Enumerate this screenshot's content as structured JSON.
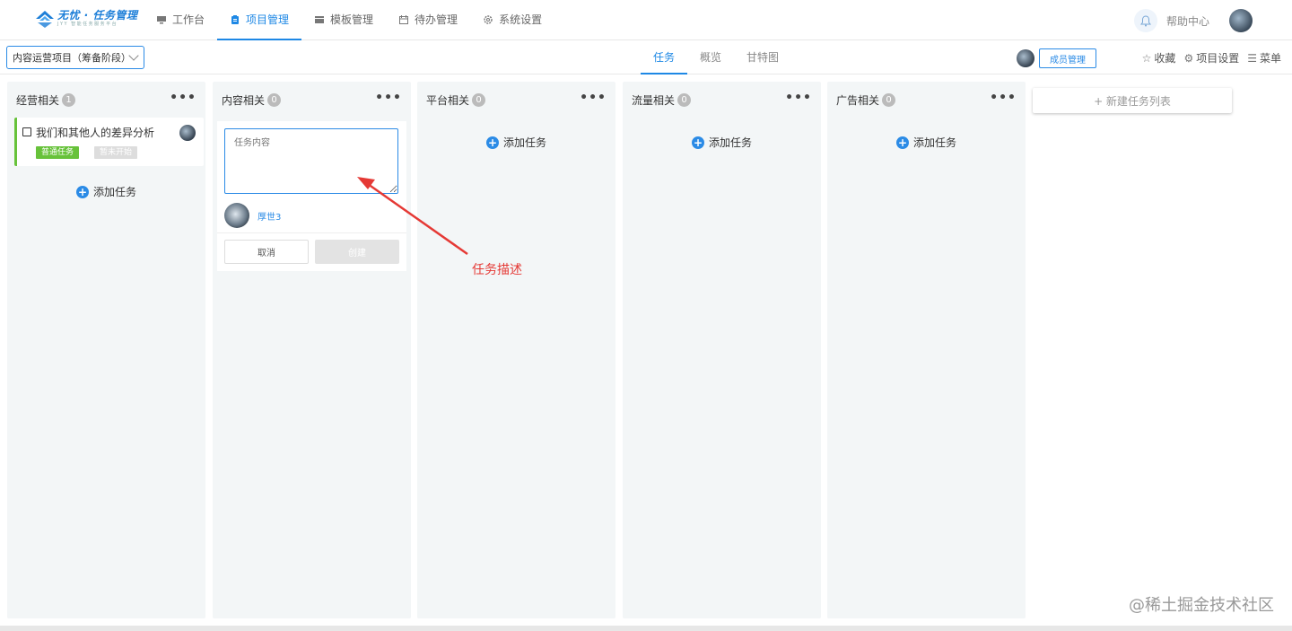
{
  "app": {
    "logo_text": "无忧 · 任务管理",
    "logo_sub": "JYY 智能任务服务平台"
  },
  "nav": {
    "items": [
      {
        "label": "工作台",
        "icon": "monitor-icon"
      },
      {
        "label": "项目管理",
        "icon": "clipboard-icon",
        "active": true
      },
      {
        "label": "模板管理",
        "icon": "template-icon"
      },
      {
        "label": "待办管理",
        "icon": "calendar-icon"
      },
      {
        "label": "系统设置",
        "icon": "gear-icon"
      }
    ],
    "help_label": "帮助中心"
  },
  "subbar": {
    "project_select": "内容运营项目（筹备阶段）",
    "tabs": [
      {
        "label": "任务",
        "active": true
      },
      {
        "label": "概览"
      },
      {
        "label": "甘特图"
      }
    ],
    "member_button": "成员管理",
    "links": {
      "favorite": "收藏",
      "settings": "项目设置",
      "menu": "菜单"
    }
  },
  "board": {
    "add_task_label": "添加任务",
    "new_list_label": "+ 新建任务列表",
    "columns": [
      {
        "title": "经营相关",
        "count": "1"
      },
      {
        "title": "内容相关",
        "count": "0"
      },
      {
        "title": "平台相关",
        "count": "0"
      },
      {
        "title": "流量相关",
        "count": "0"
      },
      {
        "title": "广告相关",
        "count": "0"
      }
    ],
    "task": {
      "title": "我们和其他人的差异分析",
      "type_tag": "普通任务",
      "status_tag": "暂未开始"
    },
    "new_card": {
      "placeholder": "任务内容",
      "assignee": "厚世3",
      "cancel": "取消",
      "create": "创建"
    }
  },
  "annotation": {
    "text": "任务描述",
    "color": "#e53935"
  },
  "watermark": "@稀土掘金技术社区",
  "colors": {
    "accent": "#1e88e5",
    "green_tag": "#67c23a",
    "column_bg": "#f3f6f7"
  }
}
